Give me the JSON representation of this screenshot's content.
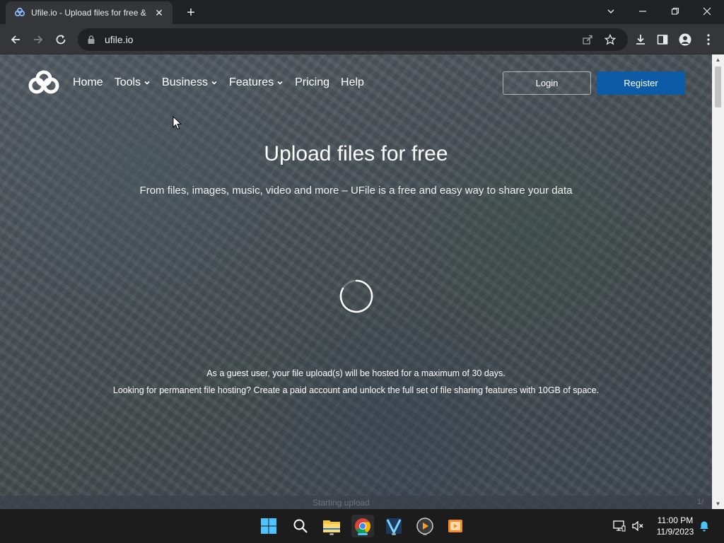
{
  "browser": {
    "tab_title": "Ufile.io - Upload files for free &",
    "url": "ufile.io"
  },
  "site": {
    "nav": [
      {
        "label": "Home",
        "has_caret": false
      },
      {
        "label": "Tools",
        "has_caret": true
      },
      {
        "label": "Business",
        "has_caret": true
      },
      {
        "label": "Features",
        "has_caret": true
      },
      {
        "label": "Pricing",
        "has_caret": false
      },
      {
        "label": "Help",
        "has_caret": false
      }
    ],
    "login_label": "Login",
    "register_label": "Register",
    "hero_title": "Upload files for free",
    "hero_subtitle": "From files, images, music, video and more – UFile is a free and easy way to share your data",
    "note_line1": "As a guest user, your file upload(s) will be hosted for a maximum of 30 days.",
    "note_line2": "Looking for permanent file hosting? Create a paid account and unlock the full set of file sharing features with 10GB of space.",
    "bottom_status": "Starting upload",
    "bottom_right": "1/"
  },
  "taskbar": {
    "time": "11:00 PM",
    "date": "11/9/2023"
  },
  "colors": {
    "register_bg": "#0d5aa7",
    "chrome_bg": "#202124",
    "toolbar_bg": "#35363a"
  }
}
